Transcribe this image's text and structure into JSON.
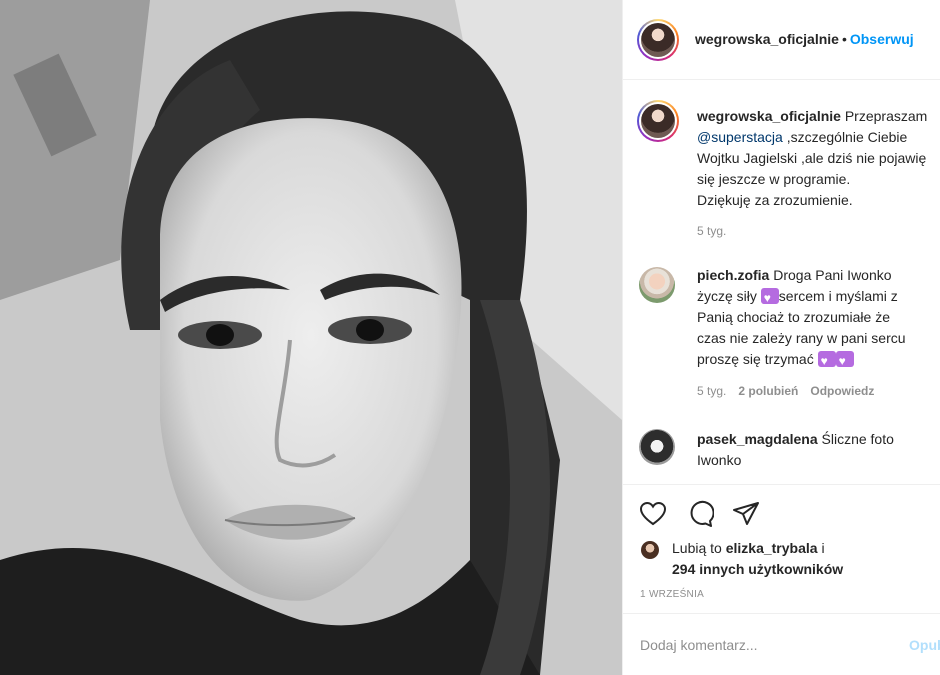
{
  "post": {
    "username": "wegrowska_oficjalnie",
    "header_username": "wegrowska_oficjalnie",
    "separator": "•",
    "follow_label": "Obserwuj"
  },
  "caption": {
    "username": "wegrowska_oficjalnie",
    "lines": [
      "Przepraszam",
      ",szczególnie Ciebie",
      "Wojtku Jagielski ,ale dziś nie pojawię",
      "się jeszcze w programie.",
      "Dziękuję za zrozumienie."
    ],
    "mention": "@superstacja",
    "time": "5 tyg."
  },
  "comments": [
    {
      "username": "piech.zofia",
      "lines": [
        "Droga Pani Iwonko",
        "życzę siły",
        "sercem i myślami z",
        "Panią chociaż to zrozumiałe że",
        "czas nie zależy rany w pani sercu",
        "proszę się trzymać"
      ],
      "time": "5 tyg.",
      "likes": "2 polubień",
      "reply": "Odpowiedz"
    },
    {
      "username": "pasek_magdalena",
      "lines": [
        "Śliczne foto",
        "Iwonko"
      ]
    }
  ],
  "likes": {
    "prefix": "Lubią to",
    "user": "elizka_trybala",
    "suffix": "i",
    "others": "294 innych użytkowników"
  },
  "date": "1 WRZEŚNIA",
  "add_comment": {
    "placeholder": "Dodaj komentarz...",
    "publish": "Opublikuj"
  },
  "icons": [
    "heart-icon",
    "comment-icon",
    "share-icon"
  ]
}
